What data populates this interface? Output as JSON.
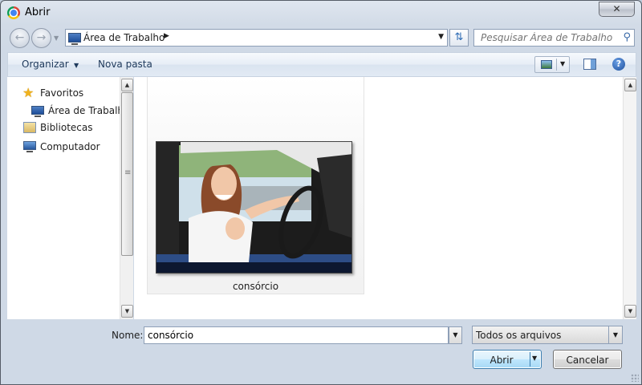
{
  "window": {
    "title": "Abrir",
    "close_glyph": "✕",
    "app_icon": "chrome-icon"
  },
  "address_bar": {
    "back_icon": "back-arrow-icon",
    "forward_icon": "forward-arrow-icon",
    "location": "Área de Trabalho",
    "location_icon": "desktop-icon",
    "refresh_icon": "refresh-icon"
  },
  "search": {
    "placeholder": "Pesquisar Área de Trabalho",
    "icon": "search-icon"
  },
  "toolbar": {
    "organize_label": "Organizar",
    "new_folder_label": "Nova pasta",
    "view_icon": "change-view-icon",
    "preview_pane_icon": "preview-pane-icon",
    "help_icon": "help-icon",
    "help_glyph": "?"
  },
  "nav": {
    "items": [
      {
        "label": "Favoritos",
        "icon": "star-icon"
      },
      {
        "label": "Área de Trabalho",
        "icon": "desktop-icon"
      },
      {
        "label": "Bibliotecas",
        "icon": "library-icon"
      },
      {
        "label": "Computador",
        "icon": "computer-icon"
      }
    ]
  },
  "files": [
    {
      "name": "consórcio",
      "thumbnail": "photo of smiling woman driving a car giving thumbs up"
    }
  ],
  "bottom": {
    "name_label": "Nome:",
    "name_value": "consórcio",
    "file_type": "Todos os arquivos",
    "open_label": "Abrir",
    "cancel_label": "Cancelar"
  },
  "colors": {
    "accent": "#3c7fb1",
    "link_text": "#1e395b",
    "chrome_bg": "#d2dbe7"
  }
}
